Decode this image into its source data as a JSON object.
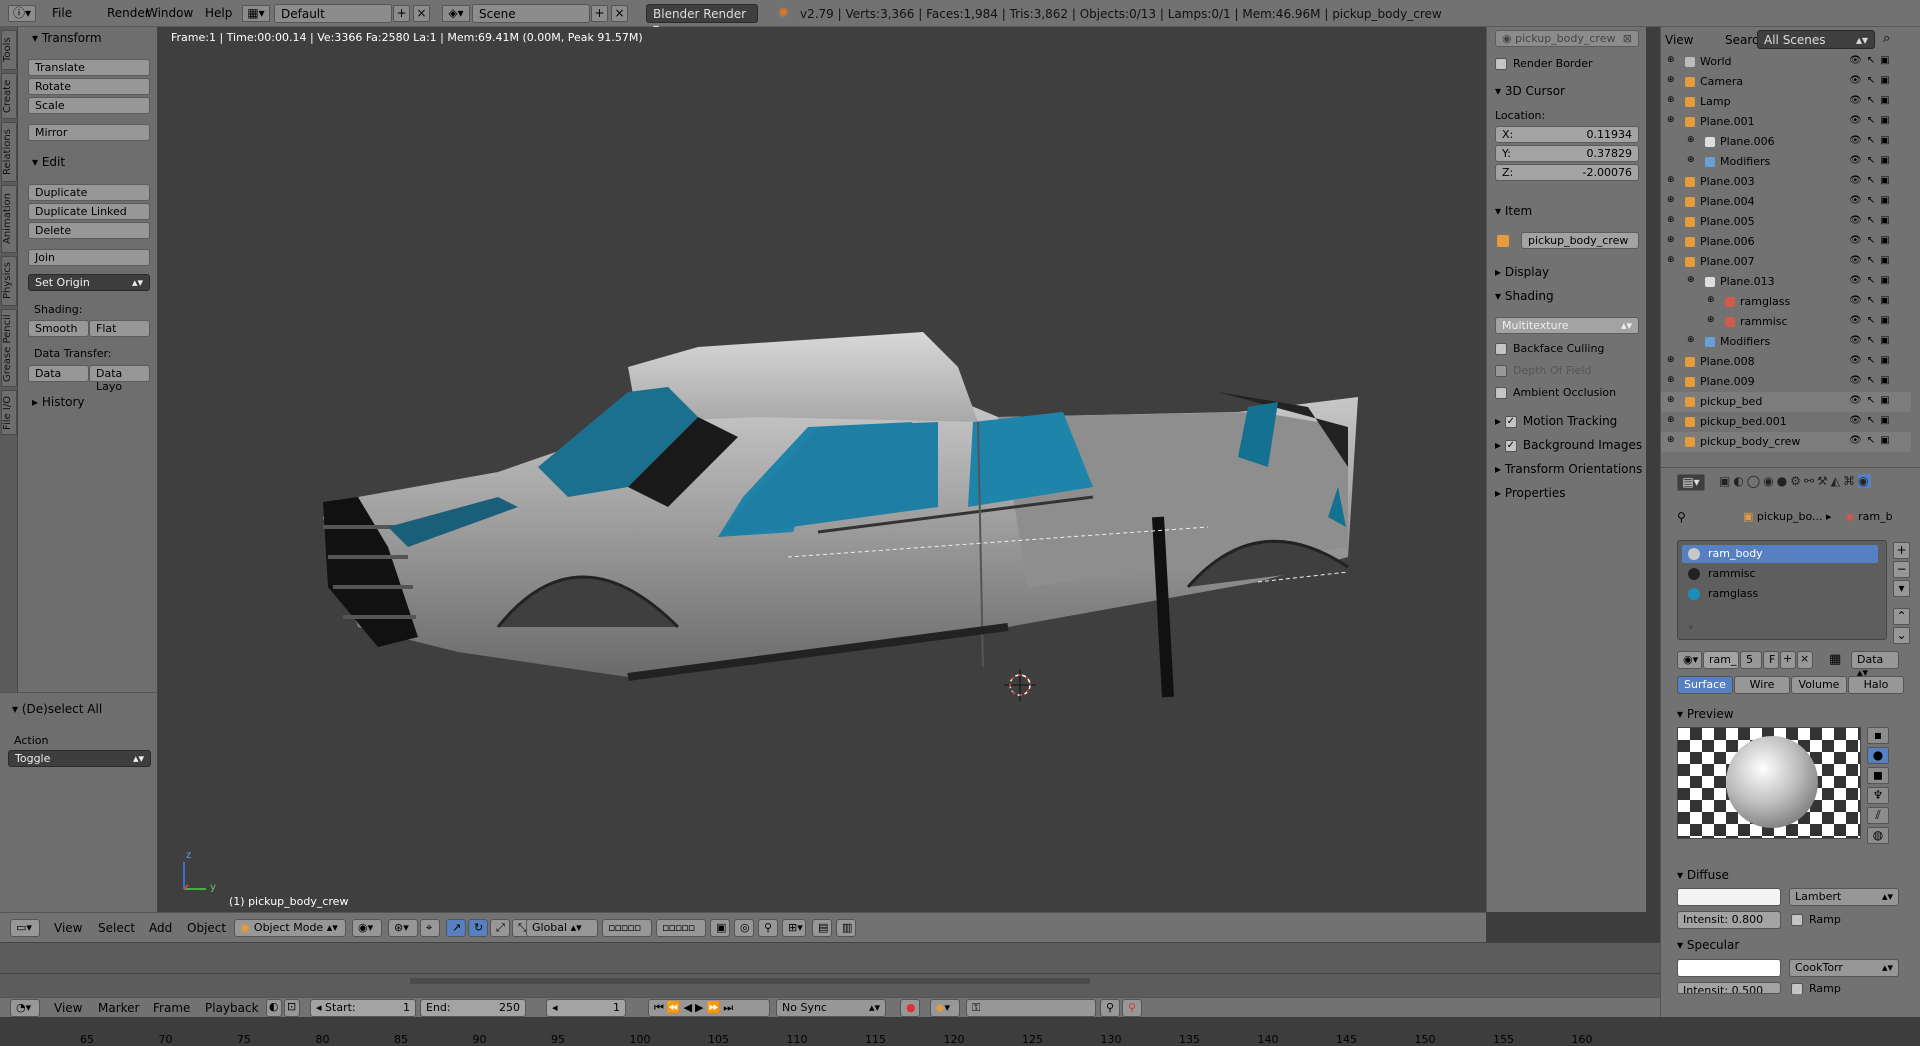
{
  "topbar": {
    "menu": [
      "File",
      "Render",
      "Window",
      "Help"
    ],
    "layout": "Default",
    "scene": "Scene",
    "engine": "Blender Render",
    "stats": "v2.79 | Verts:3,366 | Faces:1,984 | Tris:3,862 | Objects:0/13 | Lamps:0/1 | Mem:46.96M | pickup_body_crew"
  },
  "tool_tabs": [
    "Tools",
    "Create",
    "Relations",
    "Animation",
    "Physics",
    "Grease Pencil",
    "File I/O"
  ],
  "tool_shelf": {
    "transform_title": "Transform",
    "translate": "Translate",
    "rotate": "Rotate",
    "scale": "Scale",
    "mirror": "Mirror",
    "edit_title": "Edit",
    "duplicate": "Duplicate",
    "duplicate_linked": "Duplicate Linked",
    "delete": "Delete",
    "join": "Join",
    "set_origin": "Set Origin",
    "shading_label": "Shading:",
    "smooth": "Smooth",
    "flat": "Flat",
    "data_transfer_label": "Data Transfer:",
    "data": "Data",
    "data_layout": "Data Layo",
    "history_title": "History"
  },
  "redo_panel": {
    "title": "(De)select All",
    "action_label": "Action",
    "action_value": "Toggle"
  },
  "viewport": {
    "info": "Frame:1 | Time:00:00.14 | Ve:3366 Fa:2580 La:1 | Mem:69.41M (0.00M, Peak 91.57M)",
    "object_label": "(1) pickup_body_crew",
    "axis_z": "z",
    "axis_y": "y"
  },
  "n_panel": {
    "search_placeholder": "pickup_body_crew",
    "render_border": "Render Border",
    "cursor_title": "3D Cursor",
    "location_label": "Location:",
    "x_label": "X:",
    "x_value": "0.11934",
    "y_label": "Y:",
    "y_value": "0.37829",
    "z_label": "Z:",
    "z_value": "-2.00076",
    "item_title": "Item",
    "item_name": "pickup_body_crew",
    "display_title": "Display",
    "shading_title": "Shading",
    "shading_mode": "Multitexture",
    "backface_culling": "Backface Culling",
    "depth_of_field": "Depth Of Field",
    "ambient_occlusion": "Ambient Occlusion",
    "motion_tracking": "Motion Tracking",
    "background_images": "Background Images",
    "transform_orientations": "Transform Orientations",
    "properties": "Properties"
  },
  "outliner": {
    "view": "View",
    "search": "Search",
    "scenes": "All Scenes",
    "rows": [
      {
        "label": "World",
        "indent": 0,
        "icon": "#bbb"
      },
      {
        "label": "Camera",
        "indent": 0,
        "icon": "#e59b3a"
      },
      {
        "label": "Lamp",
        "indent": 0,
        "icon": "#e59b3a"
      },
      {
        "label": "Plane.001",
        "indent": 0,
        "icon": "#e59b3a"
      },
      {
        "label": "Plane.006",
        "indent": 1,
        "icon": "#ddd"
      },
      {
        "label": "Modifiers",
        "indent": 1,
        "icon": "#6a9fd8"
      },
      {
        "label": "Plane.003",
        "indent": 0,
        "icon": "#e59b3a"
      },
      {
        "label": "Plane.004",
        "indent": 0,
        "icon": "#e59b3a"
      },
      {
        "label": "Plane.005",
        "indent": 0,
        "icon": "#e59b3a"
      },
      {
        "label": "Plane.006",
        "indent": 0,
        "icon": "#e59b3a"
      },
      {
        "label": "Plane.007",
        "indent": 0,
        "icon": "#e59b3a"
      },
      {
        "label": "Plane.013",
        "indent": 1,
        "icon": "#ddd"
      },
      {
        "label": "ramglass",
        "indent": 2,
        "icon": "#d05a4a"
      },
      {
        "label": "rammisc",
        "indent": 2,
        "icon": "#d05a4a"
      },
      {
        "label": "Modifiers",
        "indent": 1,
        "icon": "#6a9fd8"
      },
      {
        "label": "Plane.008",
        "indent": 0,
        "icon": "#e59b3a"
      },
      {
        "label": "Plane.009",
        "indent": 0,
        "icon": "#e59b3a"
      },
      {
        "label": "pickup_bed",
        "indent": 0,
        "icon": "#e59b3a"
      },
      {
        "label": "pickup_bed.001",
        "indent": 0,
        "icon": "#e59b3a"
      },
      {
        "label": "pickup_body_crew",
        "indent": 0,
        "icon": "#e59b3a"
      }
    ]
  },
  "properties": {
    "breadcrumb_object": "pickup_bo...",
    "breadcrumb_material": "ram_b",
    "materials": [
      {
        "name": "ram_body",
        "color": "#c8c8c8"
      },
      {
        "name": "rammisc",
        "color": "#222222"
      },
      {
        "name": "ramglass",
        "color": "#1a8fb8"
      }
    ],
    "mat_name": "ram_",
    "mat_users": "5",
    "mat_fake": "F",
    "link": "Data",
    "tabs": [
      "Surface",
      "Wire",
      "Volume",
      "Halo"
    ],
    "preview_title": "Preview",
    "diffuse_title": "Diffuse",
    "diffuse_shader": "Lambert",
    "intensity_label": "Intensit:",
    "diffuse_intensity": "0.800",
    "ramp": "Ramp",
    "specular_title": "Specular",
    "specular_shader": "CookTorr",
    "specular_intensity": "0.500"
  },
  "view_header": {
    "menu": [
      "View",
      "Select",
      "Add",
      "Object"
    ],
    "mode": "Object Mode",
    "orientation": "Global"
  },
  "timeline": {
    "ticks": [
      "65",
      "70",
      "75",
      "80",
      "85",
      "90",
      "95",
      "100",
      "105",
      "110",
      "115",
      "120",
      "125",
      "130",
      "135",
      "140",
      "145",
      "150",
      "155",
      "160"
    ],
    "menu": [
      "View",
      "Marker",
      "Frame",
      "Playback"
    ],
    "start_label": "Start:",
    "start": "1",
    "end_label": "End:",
    "end": "250",
    "current": "1",
    "sync": "No Sync"
  }
}
